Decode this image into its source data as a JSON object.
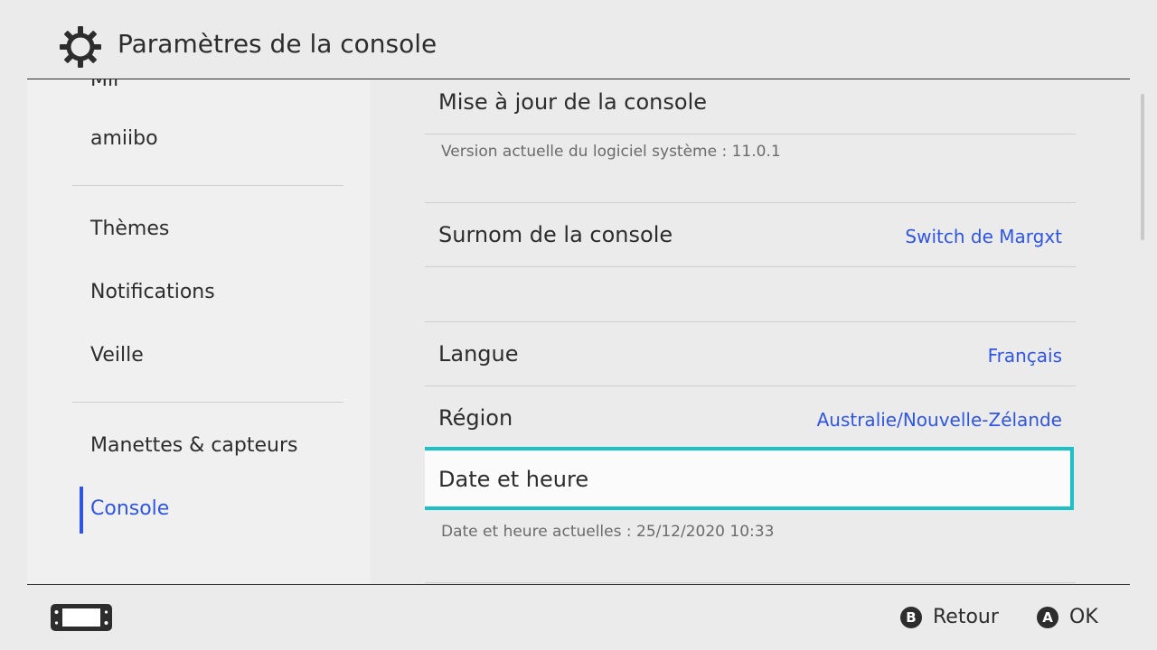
{
  "header": {
    "title": "Paramètres de la console",
    "icon": "gear-icon"
  },
  "sidebar": {
    "items": [
      {
        "label": "Mii"
      },
      {
        "label": "amiibo"
      },
      {
        "label": "Thèmes"
      },
      {
        "label": "Notifications"
      },
      {
        "label": "Veille"
      },
      {
        "label": "Manettes & capteurs"
      },
      {
        "label": "Console",
        "active": true
      }
    ]
  },
  "main": {
    "update": {
      "title": "Mise à jour de la console",
      "sub": "Version actuelle du logiciel système : 11.0.1"
    },
    "nickname": {
      "title": "Surnom de la console",
      "value": "Switch de Margxt"
    },
    "language": {
      "title": "Langue",
      "value": "Français"
    },
    "region": {
      "title": "Région",
      "value": "Australie/Nouvelle-Zélande"
    },
    "datetime": {
      "title": "Date et heure",
      "sub": "Date et heure actuelles : 25/12/2020 10:33"
    }
  },
  "footer": {
    "back": {
      "key": "B",
      "label": "Retour"
    },
    "ok": {
      "key": "A",
      "label": "OK"
    }
  },
  "colors": {
    "accent": "#2f55e6",
    "selection": "#1ec0c8",
    "text": "#2d2d2d"
  }
}
